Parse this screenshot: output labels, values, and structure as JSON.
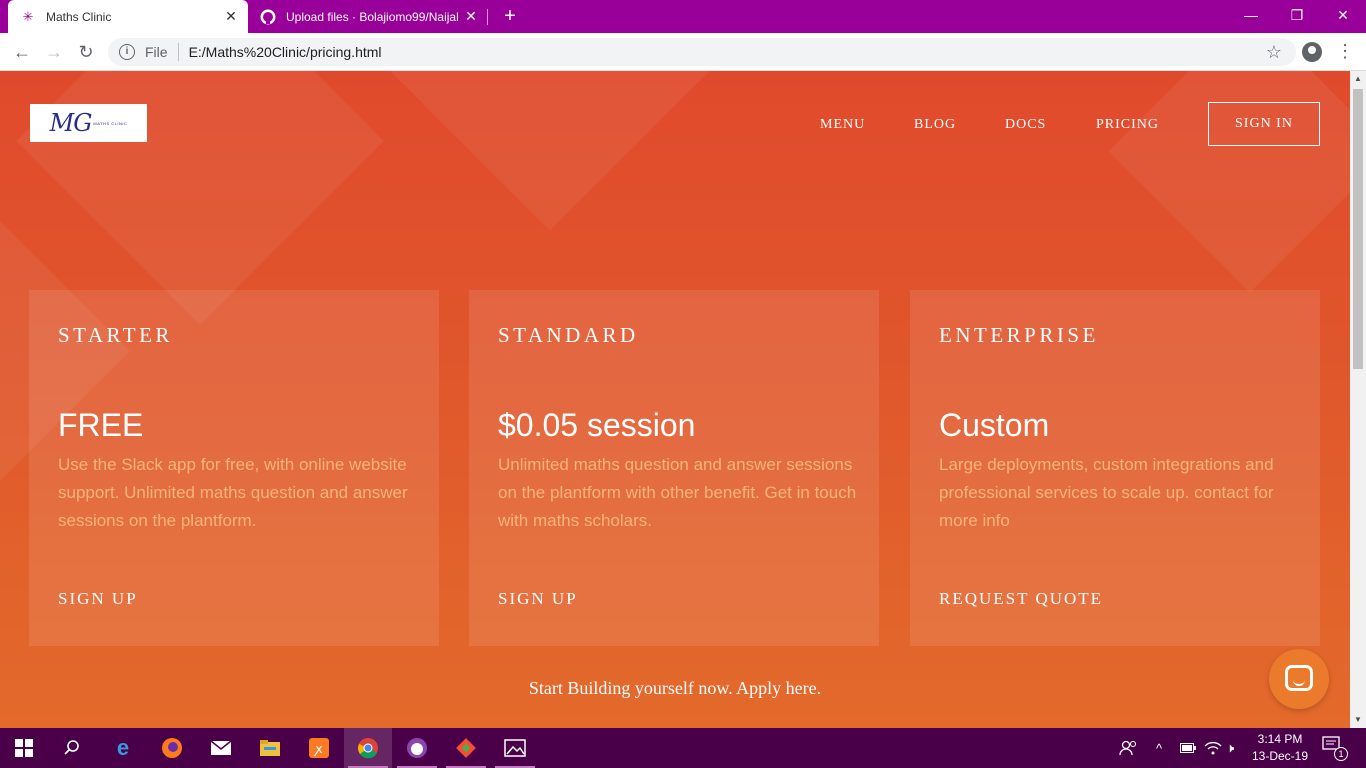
{
  "browser": {
    "tabs": [
      {
        "title": "Maths Clinic",
        "favicon": "maths-clinic-favicon",
        "active": true
      },
      {
        "title": "Upload files · Bolajiomo99/Naijal",
        "favicon": "github-icon",
        "active": false
      }
    ],
    "address": {
      "scheme_label": "File",
      "url": "E:/Maths%20Clinic/pricing.html"
    },
    "accent_color": "#990099"
  },
  "site": {
    "logo_text": "MG",
    "logo_small_text": "MATHS CLINIC",
    "nav": {
      "menu": "MENU",
      "blog": "BLOG",
      "docs": "DOCS",
      "pricing": "PRICING",
      "sign_in": "SIGN IN"
    },
    "plans": [
      {
        "name": "STARTER",
        "price": "FREE",
        "description": "Use the Slack app for free, with online website support. Unlimited maths question and answer sessions on the plantform.",
        "cta": "SIGN UP"
      },
      {
        "name": "STANDARD",
        "price": "$0.05 session",
        "description": "Unlimited maths question and answer sessions on the plantform with other benefit. Get in touch with maths scholars.",
        "cta": "SIGN UP"
      },
      {
        "name": "ENTERPRISE",
        "price": "Custom",
        "description": "Large deployments, custom integrations and professional services to scale up. contact for more info",
        "cta": "REQUEST QUOTE"
      }
    ],
    "footer_text": "Start Building yourself now. Apply here.",
    "colors": {
      "background_top": "#e04a2c",
      "background_bottom": "#e36a2b",
      "description": "#f6b37a",
      "chat_button": "#ec7a2c"
    }
  },
  "taskbar": {
    "apps": [
      "windows-start-icon",
      "search-icon",
      "edge-icon",
      "firefox-icon",
      "mail-icon",
      "file-explorer-icon",
      "xampp-icon",
      "chrome-icon",
      "github-desktop-icon",
      "git-icon",
      "photos-icon"
    ],
    "time": "3:14 PM",
    "date": "13-Dec-19",
    "notification_count": "1"
  }
}
